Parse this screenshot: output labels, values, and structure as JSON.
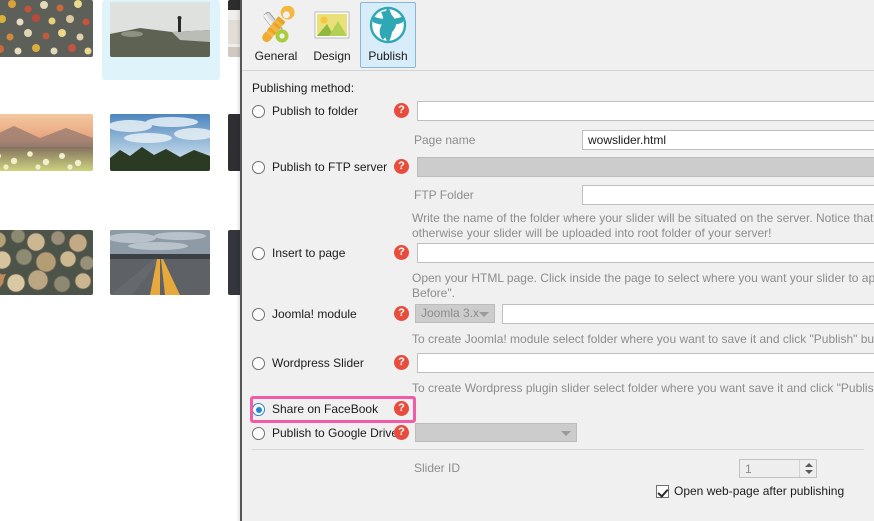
{
  "toolbar": {
    "tabs": [
      {
        "label": "General",
        "icon": "wrench-screwdriver-icon",
        "selected": false
      },
      {
        "label": "Design",
        "icon": "picture-icon",
        "selected": false
      },
      {
        "label": "Publish",
        "icon": "globe-icon",
        "selected": true
      }
    ]
  },
  "dialog": {
    "section_label": "Publishing method:",
    "help_glyph": "?",
    "methods": [
      {
        "id": "publish-to-folder",
        "label": "Publish to folder",
        "selected": false,
        "field_value": ""
      },
      {
        "id": "publish-to-ftp-server",
        "label": "Publish to FTP server",
        "selected": false,
        "field_value": ""
      },
      {
        "id": "insert-to-page",
        "label": "Insert to page",
        "selected": false,
        "field_value": ""
      },
      {
        "id": "joomla-module",
        "label": "Joomla! module",
        "selected": false,
        "version_value": "Joomla 3.x",
        "field_value": ""
      },
      {
        "id": "wordpress-slider",
        "label": "Wordpress Slider",
        "selected": false,
        "field_value": ""
      },
      {
        "id": "share-on-facebook",
        "label": "Share on FaceBook",
        "selected": true
      },
      {
        "id": "publish-to-google-drive",
        "label": "Publish to Google Drive",
        "selected": false,
        "folder_value": ""
      }
    ],
    "page_name_label": "Page name",
    "page_name_value": "wowslider.html",
    "ftp_folder_label": "FTP Folder",
    "ftp_folder_value": "",
    "hints": {
      "ftp": "Write the name of the folder where your slider will be situated on the server. Notice that you sh\notherwise your slider will be uploaded into root folder of your server!",
      "insert": "Open your HTML page. Click inside the page to select where you want your slider to appear, the\nBefore\".",
      "joomla": "To create Joomla! module select folder where you want to save it and click \"Publish\" button.",
      "wordpress": "To create Wordpress plugin slider select folder where you want save it and click \"Publish\" button"
    },
    "slider_id_label": "Slider ID",
    "slider_id_value": "1",
    "open_webpage_label": "Open web-page after publishing",
    "open_webpage_checked": true,
    "highlight_color": "#f25ba8",
    "help_color": "#e74c3c"
  },
  "thumbnails": {
    "items": [
      {
        "name": "flowers-grid-thumb",
        "selected": false
      },
      {
        "name": "person-on-cliff-thumb",
        "selected": true
      },
      {
        "name": "indoor-room-thumb",
        "selected": false
      },
      {
        "name": "meadow-sunset-thumb",
        "selected": false
      },
      {
        "name": "clouds-trees-thumb",
        "selected": false
      },
      {
        "name": "dark-edge-thumb",
        "selected": false
      },
      {
        "name": "logs-stack-thumb",
        "selected": false
      },
      {
        "name": "road-lines-thumb",
        "selected": false
      }
    ]
  }
}
